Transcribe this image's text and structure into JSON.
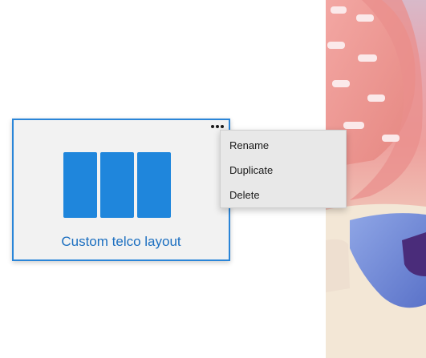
{
  "layout_card": {
    "title": "Custom telco layout",
    "more_icon": "more-horizontal-icon",
    "zone_count": 3,
    "zone_color": "#1f86dc",
    "accent_color": "#2a85d8"
  },
  "context_menu": {
    "items": [
      {
        "label": "Rename"
      },
      {
        "label": "Duplicate"
      },
      {
        "label": "Delete"
      }
    ]
  }
}
